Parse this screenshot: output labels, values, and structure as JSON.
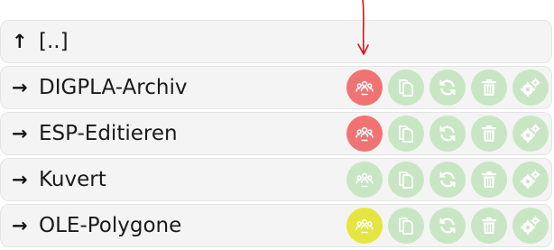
{
  "colors": {
    "row_background": "#f4f4f4",
    "action_inactive": "#c8e6c3",
    "action_active_red": "#f17272",
    "action_active_yellow": "#e5e542",
    "annotation_arrow": "#d8141a"
  },
  "parent": {
    "icon": "up-arrow-icon",
    "arrow": "↑",
    "label": "[..]"
  },
  "folders": [
    {
      "arrow": "→",
      "label": "DIGPLA-Archiv",
      "users_state": "red"
    },
    {
      "arrow": "→",
      "label": "ESP-Editieren",
      "users_state": "red"
    },
    {
      "arrow": "→",
      "label": "Kuvert",
      "users_state": "inactive"
    },
    {
      "arrow": "→",
      "label": "OLE-Polygone",
      "users_state": "yellow"
    }
  ],
  "actions": [
    {
      "name": "users-icon"
    },
    {
      "name": "copy-icon"
    },
    {
      "name": "refresh-icon"
    },
    {
      "name": "trash-icon"
    },
    {
      "name": "settings-icon"
    }
  ]
}
